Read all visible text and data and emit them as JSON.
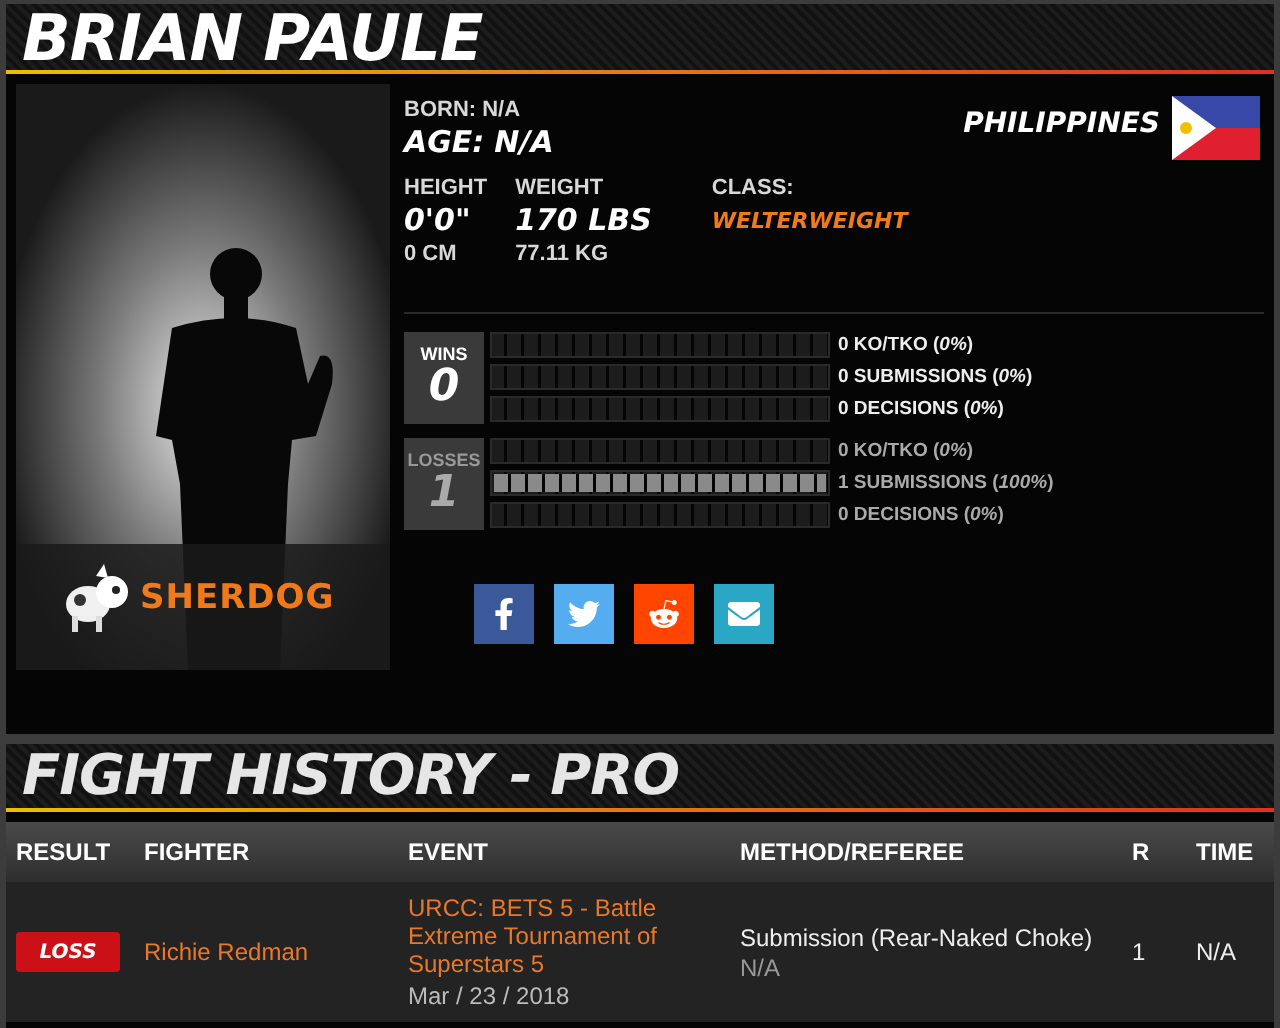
{
  "fighter": {
    "name": "BRIAN PAULE",
    "born_label": "BORN:",
    "born": "N/A",
    "age_label": "AGE:",
    "age": "N/A",
    "height_label": "HEIGHT",
    "height_ft": "0'0\"",
    "height_cm": "0 CM",
    "weight_label": "WEIGHT",
    "weight_lbs": "170 LBS",
    "weight_kg": "77.11 KG",
    "class_label": "CLASS:",
    "class": "WELTERWEIGHT",
    "country": "PHILIPPINES"
  },
  "logo": "SHERDOG",
  "record": [
    {
      "label": "WINS",
      "count": "0",
      "dimmed": false,
      "rows": [
        {
          "text": "0 KO/TKO (*0%*)",
          "level": 0
        },
        {
          "text": "0 SUBMISSIONS (*0%*)",
          "level": 0
        },
        {
          "text": "0 DECISIONS (*0%*)",
          "level": 0
        }
      ]
    },
    {
      "label": "LOSSES",
      "count": "1",
      "dimmed": true,
      "rows": [
        {
          "text": "0 KO/TKO (*0%*)",
          "level": 0
        },
        {
          "text": "1 SUBMISSIONS (*100%*)",
          "level": 1
        },
        {
          "text": "0 DECISIONS (*0%*)",
          "level": 0
        }
      ]
    }
  ],
  "share": [
    {
      "kind": "facebook"
    },
    {
      "kind": "twitter"
    },
    {
      "kind": "reddit"
    },
    {
      "kind": "email"
    }
  ],
  "fight_history": {
    "title": "FIGHT HISTORY - PRO",
    "columns": [
      "RESULT",
      "FIGHTER",
      "EVENT",
      "METHOD/REFEREE",
      "R",
      "TIME"
    ],
    "rows": [
      {
        "result": "LOSS",
        "color": "#cc1018",
        "fighter": "Richie Redman",
        "event": "URCC: BETS 5 - Battle Extreme Tournament of Superstars 5",
        "date": "Mar / 23 / 2018",
        "method": "Submission (Rear-Naked Choke)",
        "referee": "N/A",
        "round": "1",
        "time": "N/A"
      }
    ]
  }
}
